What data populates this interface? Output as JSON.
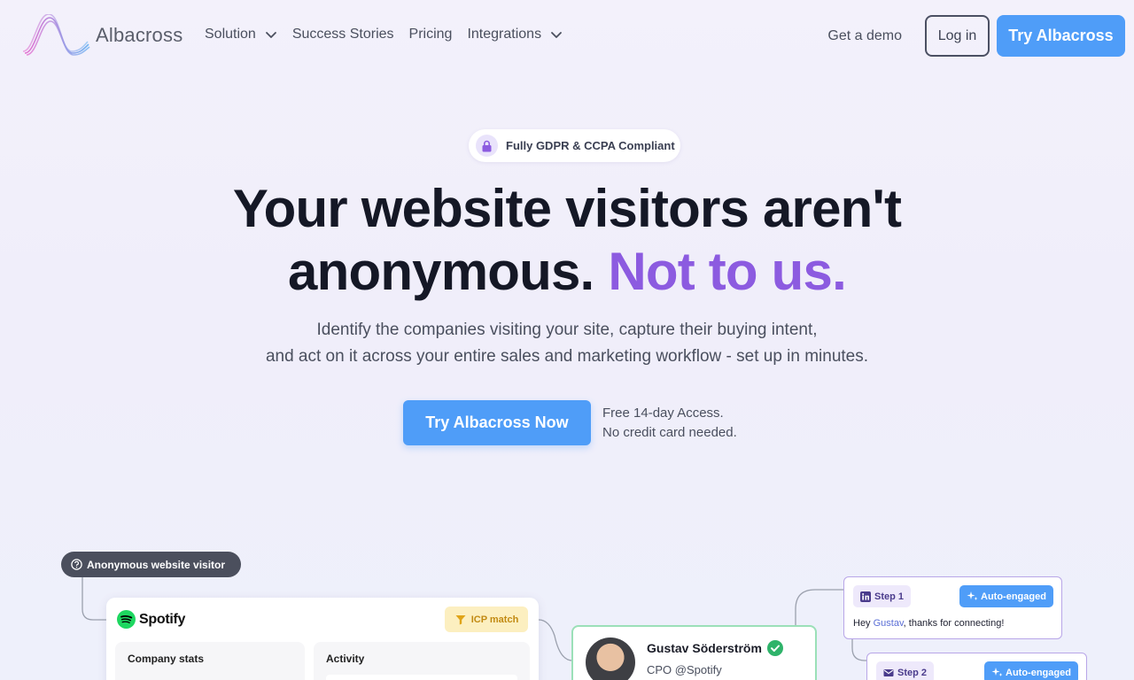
{
  "nav": {
    "logo_text": "Albacross",
    "links": [
      {
        "label": "Solution",
        "dropdown": true
      },
      {
        "label": "Success Stories",
        "dropdown": false
      },
      {
        "label": "Pricing",
        "dropdown": false
      },
      {
        "label": "Integrations",
        "dropdown": true
      }
    ],
    "demo": "Get a demo",
    "login": "Log in",
    "try": "Try Albacross"
  },
  "hero": {
    "badge": "Fully GDPR & CCPA Compliant",
    "headline_line1": "Your website visitors aren't",
    "headline_line2_plain": "anonymous.",
    "headline_line2_accent": "Not to us.",
    "subtitle_line1": "Identify the companies visiting your site, capture their buying intent,",
    "subtitle_line2": "and act on it across your entire sales and marketing workflow - set up in minutes.",
    "cta": "Try Albacross Now",
    "cta_note_line1": "Free 14-day Access.",
    "cta_note_line2": "No credit card needed."
  },
  "illustration": {
    "anon_tag": "Anonymous website visitor",
    "company": {
      "name": "Spotify",
      "icp": "ICP match",
      "stats_label": "Company stats",
      "activity_label": "Activity"
    },
    "person": {
      "name": "Gustav Söderström",
      "role": "CPO @Spotify"
    },
    "step1": {
      "label": "Step 1",
      "auto": "Auto-engaged",
      "msg_prefix": "Hey ",
      "msg_name": "Gustav",
      "msg_suffix": ", thanks for connecting!"
    },
    "step2": {
      "label": "Step 2",
      "auto": "Auto-engaged"
    }
  },
  "colors": {
    "primary": "#4f9df8",
    "accent": "#8c5be0",
    "icp_bg": "#fcefc0",
    "verified": "#2fb36a"
  }
}
